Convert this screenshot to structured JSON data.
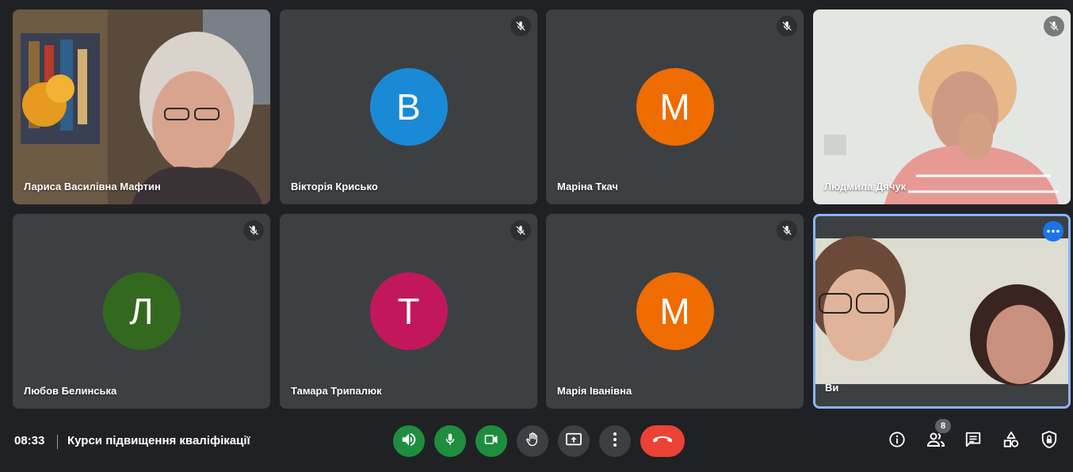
{
  "participants": [
    {
      "name": "Лариса Василівна Мафтин"
    },
    {
      "name": "Вікторія Крисько",
      "initial": "В",
      "color": "#1a8ad6"
    },
    {
      "name": "Маріна Ткач",
      "initial": "М",
      "color": "#ef6c00"
    },
    {
      "name": "Людмила Дячук"
    },
    {
      "name": "Любов Белинська",
      "initial": "Л",
      "color": "#33691e"
    },
    {
      "name": "Тамара Трипалюк",
      "initial": "Т",
      "color": "#c2185b"
    },
    {
      "name": "Марія Іванівна",
      "initial": "М",
      "color": "#ef6c00"
    },
    {
      "name": "Ви"
    }
  ],
  "bottom_bar": {
    "time": "08:33",
    "meeting_title": "Курси підвищення кваліфікації",
    "people_count": "8"
  },
  "icons": {
    "audio": "speaker-icon",
    "mic": "microphone-icon",
    "camera": "camera-icon",
    "hand": "raise-hand-icon",
    "present": "present-screen-icon",
    "more": "more-vertical-icon",
    "leave": "hang-up-icon",
    "info": "info-icon",
    "people": "people-icon",
    "chat": "chat-icon",
    "activities": "activities-icon",
    "host": "host-controls-icon"
  }
}
